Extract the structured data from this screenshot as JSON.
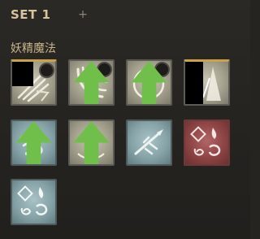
{
  "header": {
    "title": "SET 1",
    "add_icon": "plus-icon"
  },
  "category": {
    "label": "妖精魔法"
  },
  "skills": [
    {
      "slot": 1,
      "icon": "slash-skill-icon",
      "theme": "light",
      "cooldown_indicator": true,
      "upgrade": false,
      "equipped": true
    },
    {
      "slot": 2,
      "icon": "wind-blade-icon",
      "theme": "light",
      "cooldown_indicator": true,
      "upgrade": true,
      "equipped": false
    },
    {
      "slot": 3,
      "icon": "water-swirl-icon",
      "theme": "light",
      "cooldown_indicator": true,
      "upgrade": true,
      "equipped": false
    },
    {
      "slot": 4,
      "icon": "light-beam-icon",
      "theme": "light",
      "cooldown_indicator": false,
      "upgrade": false,
      "equipped": true
    },
    {
      "slot": 5,
      "icon": "wind-swirl-icon",
      "theme": "teal",
      "cooldown_indicator": false,
      "upgrade": true,
      "equipped": false
    },
    {
      "slot": 6,
      "icon": "spirit-burst-icon",
      "theme": "light",
      "cooldown_indicator": false,
      "upgrade": true,
      "equipped": false
    },
    {
      "slot": 7,
      "icon": "leaf-dash-icon",
      "theme": "teal",
      "cooldown_indicator": false,
      "upgrade": false,
      "equipped": false
    },
    {
      "slot": 8,
      "icon": "element-fusion-icon",
      "theme": "red",
      "cooldown_indicator": false,
      "upgrade": false,
      "equipped": false
    },
    {
      "slot": 9,
      "icon": "element-fusion-icon",
      "theme": "teal",
      "cooldown_indicator": false,
      "upgrade": false,
      "equipped": false
    }
  ],
  "colors": {
    "upgrade_arrow": "#6fbf4a",
    "gold_trim": "#c9a24a",
    "title": "#d8c49a"
  }
}
